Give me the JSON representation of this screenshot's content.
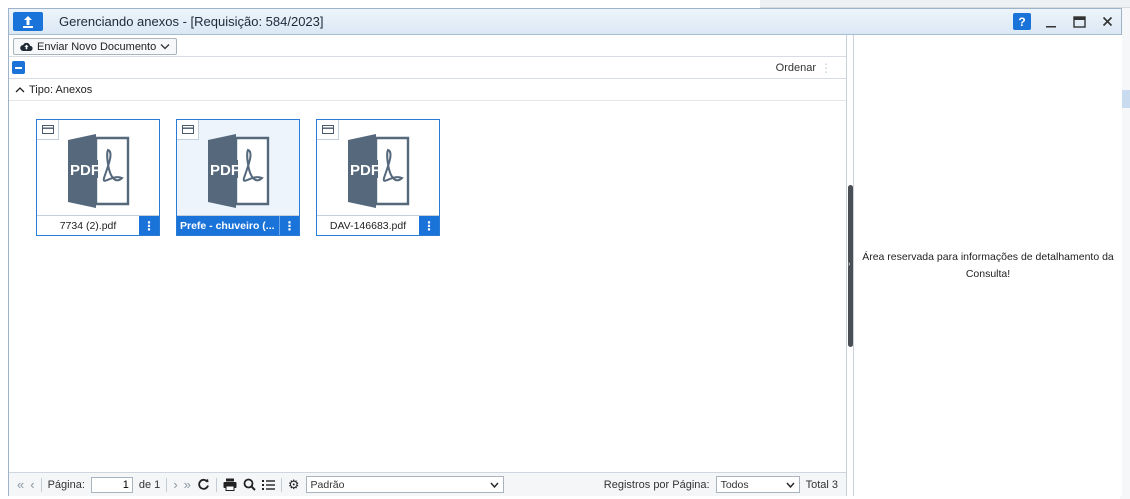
{
  "window": {
    "title": "Gerenciando anexos - [Requisição: 584/2023]",
    "help_label": "?"
  },
  "toolbar": {
    "send_label": "Enviar Novo Documento"
  },
  "sortbar": {
    "order_label": "Ordenar"
  },
  "group": {
    "label_prefix": "Tipo",
    "label_value": ": Anexos"
  },
  "cards": [
    {
      "name": "7734 (2).pdf",
      "selected": false
    },
    {
      "name": "Prefe - chuveiro (...",
      "selected": true
    },
    {
      "name": "DAV-146683.pdf",
      "selected": false
    }
  ],
  "thumb_label": "PDF",
  "pager": {
    "page_label": "Página:",
    "page_value": "1",
    "of_label": "de 1",
    "layout_value": "Padrão",
    "per_page_label": "Registros por Página:",
    "per_page_value": "Todos",
    "total_label": "Total 3"
  },
  "detail": {
    "message": "Área reservada para informações de detalhamento da Consulta!"
  },
  "colors": {
    "accent": "#1a73d9",
    "pdf_gray": "#55687c"
  }
}
